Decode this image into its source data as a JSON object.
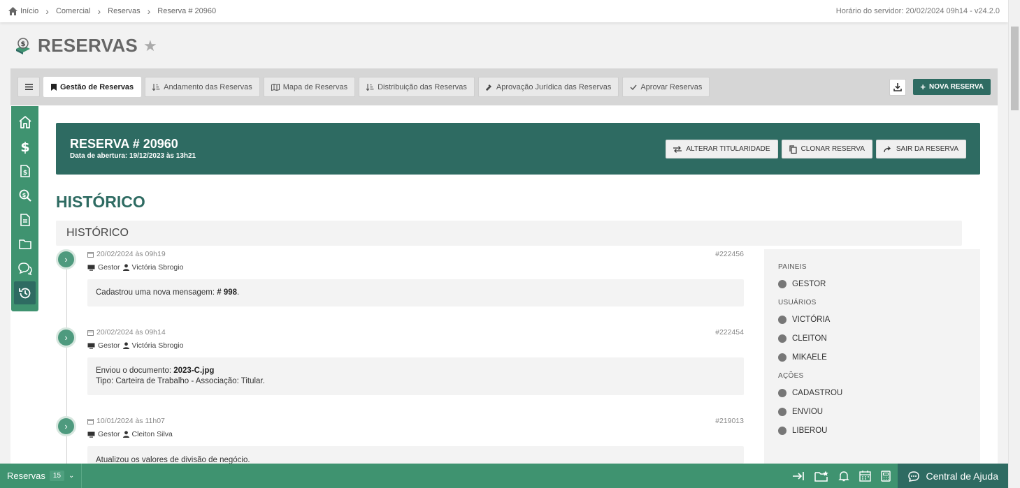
{
  "breadcrumb": [
    "Início",
    "Comercial",
    "Reservas",
    "Reserva # 20960"
  ],
  "server_time": "Horário do servidor: 20/02/2024 09h14 - v24.2.0",
  "page_title": "RESERVAS",
  "tabs": [
    {
      "label": "Gestão de Reservas",
      "icon": "bookmark-icon"
    },
    {
      "label": "Andamento das Reservas",
      "icon": "sort-icon"
    },
    {
      "label": "Mapa de Reservas",
      "icon": "map-icon"
    },
    {
      "label": "Distribuição das Reservas",
      "icon": "sort-icon"
    },
    {
      "label": "Aprovação Jurídica das Reservas",
      "icon": "gavel-icon"
    },
    {
      "label": "Aprovar Reservas",
      "icon": "check-icon"
    }
  ],
  "new_reserva": "NOVA RESERVA",
  "reserva": {
    "number": "RESERVA # 20960",
    "opened": "Data de abertura: 19/12/2023 às 13h21",
    "actions": [
      "ALTERAR TITULARIDADE",
      "CLONAR RESERVA",
      "SAIR DA RESERVA"
    ]
  },
  "historico_title": "HISTÓRICO",
  "historico_bar": "HISTÓRICO",
  "entries": [
    {
      "date": "20/02/2024 às 09h19",
      "id": "#222456",
      "panel": "Gestor",
      "user": "Victória Sbrogio",
      "text": "Cadastrou uma nova mensagem: ",
      "bold": "# 998",
      "suffix": ".",
      "line2": ""
    },
    {
      "date": "20/02/2024 às 09h14",
      "id": "#222454",
      "panel": "Gestor",
      "user": "Victória Sbrogio",
      "text": "Enviou o documento: ",
      "bold": "2023-C.jpg",
      "suffix": "",
      "line2": "Tipo: Carteira de Trabalho - Associação: Titular."
    },
    {
      "date": "10/01/2024 às 11h07",
      "id": "#219013",
      "panel": "Gestor",
      "user": "Cleiton Silva",
      "text": "Atualizou os valores de divisão de negócio.",
      "bold": "",
      "suffix": "",
      "line2": ""
    }
  ],
  "filters": {
    "paineis_label": "PAINEIS",
    "paineis": [
      "GESTOR"
    ],
    "usuarios_label": "USUÁRIOS",
    "usuarios": [
      "VICTÓRIA",
      "CLEITON",
      "MIKAELE"
    ],
    "acoes_label": "AÇÕES",
    "acoes": [
      "CADASTROU",
      "ENVIOU",
      "LIBEROU"
    ]
  },
  "bottom": {
    "reservas_label": "Reservas",
    "reservas_count": "15",
    "help": "Central de Ajuda"
  },
  "colors": {
    "primary": "#2e6b62",
    "accent": "#3f9370"
  }
}
